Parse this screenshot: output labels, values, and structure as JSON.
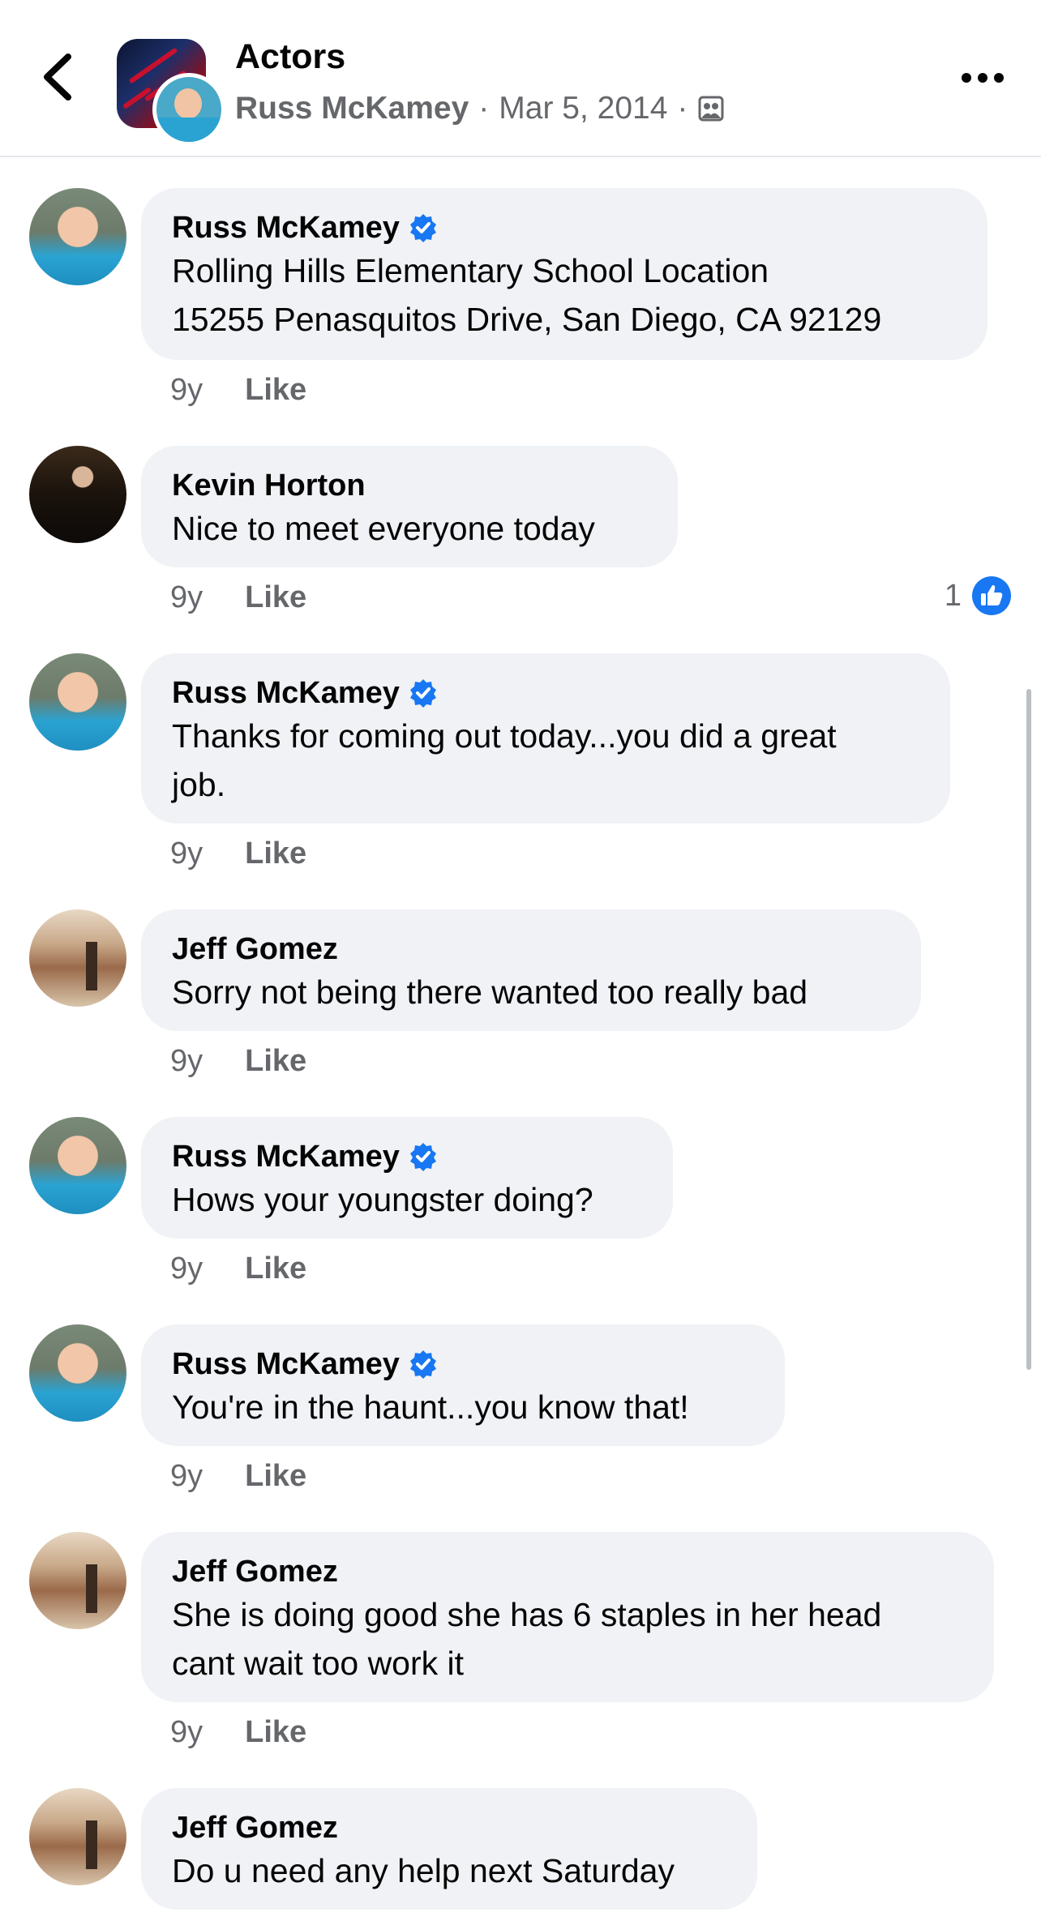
{
  "header": {
    "title": "Actors",
    "author": "Russ McKamey",
    "separator": "·",
    "date": "Mar 5, 2014",
    "separator2": "·",
    "back_icon": "chevron-left-icon",
    "audience_icon": "group-icon",
    "more_icon": "more-horizontal-icon"
  },
  "colors": {
    "verified": "#1877f2",
    "bubble": "#f0f2f5",
    "meta": "#65676b",
    "like_reaction": "#1877f2"
  },
  "comments": [
    {
      "author": "Russ McKamey",
      "verified": true,
      "text": "Rolling Hills Elementary School Location\n15255 Penasquitos Drive, San Diego, CA 92129",
      "age": "9y",
      "like_label": "Like"
    },
    {
      "author": "Kevin Horton",
      "verified": false,
      "text": "Nice to meet everyone today",
      "age": "9y",
      "like_label": "Like",
      "reaction_count": "1"
    },
    {
      "author": "Russ McKamey",
      "verified": true,
      "text": "Thanks for coming out today...you did a great\njob.",
      "age": "9y",
      "like_label": "Like"
    },
    {
      "author": "Jeff Gomez",
      "verified": false,
      "text": "Sorry not being there wanted too really bad",
      "age": "9y",
      "like_label": "Like"
    },
    {
      "author": "Russ McKamey",
      "verified": true,
      "text": "Hows your youngster doing?",
      "age": "9y",
      "like_label": "Like"
    },
    {
      "author": "Russ McKamey",
      "verified": true,
      "text": "You're in the haunt...you know that!",
      "age": "9y",
      "like_label": "Like"
    },
    {
      "author": "Jeff Gomez",
      "verified": false,
      "text": "She is doing good she has 6 staples in her head\ncant wait too work it",
      "age": "9y",
      "like_label": "Like"
    },
    {
      "author": "Jeff Gomez",
      "verified": false,
      "text": "Do u need any help next Saturday"
    }
  ]
}
